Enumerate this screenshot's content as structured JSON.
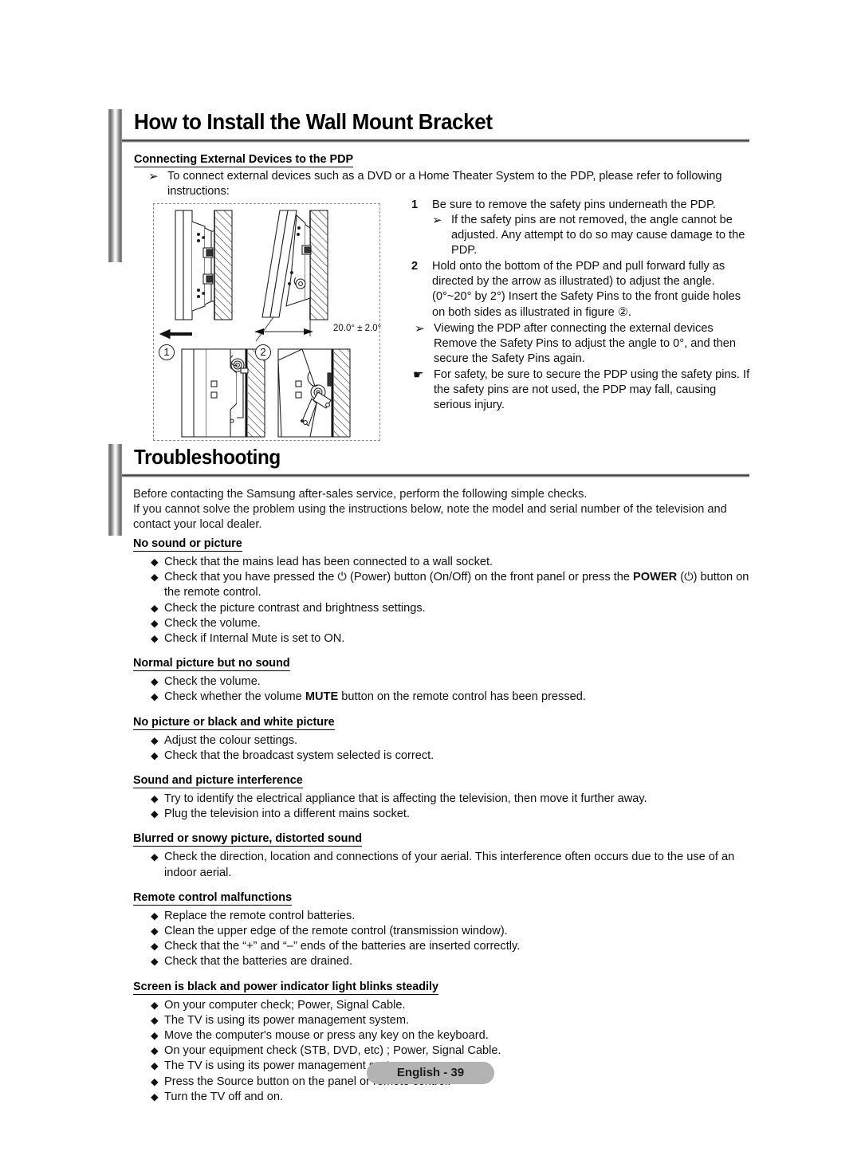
{
  "page": {
    "footer_label": "English - 39",
    "background": "#ffffff",
    "rail_color": "#8f8f8f"
  },
  "section1": {
    "title": "How to Install the Wall Mount Bracket",
    "subhead": "Connecting External Devices to the PDP",
    "intro": "To connect external devices such as a DVD or a Home Theater System to the PDP, please refer to following instructions:",
    "arrow_glyph": "➢",
    "hand_glyph": "☛",
    "steps": [
      {
        "num": "1",
        "text": "Be sure to remove the safety pins underneath the PDP.",
        "sub": "If the safety pins are not removed, the angle cannot be adjusted. Any attempt to do so may cause damage to the PDP."
      },
      {
        "num": "2",
        "text": "Hold onto the bottom of the PDP and pull forward fully as directed by the arrow as illustrated) to adjust the angle. (0°~20° by 2°) Insert the Safety Pins to the front guide holes on both sides as illustrated in figure ②."
      }
    ],
    "notes": [
      {
        "glyph": "arrow",
        "text": "Viewing the PDP after connecting the external devices Remove the Safety Pins to adjust the angle to 0°, and then secure the Safety Pins again."
      },
      {
        "glyph": "hand",
        "text": "For safety, be sure to secure the PDP using the safety pins. If the safety pins are not used, the PDP may fall, causing serious injury."
      }
    ],
    "figure": {
      "label_1": "①",
      "label_2": "②",
      "angle_label": "20.0° ± 2.0°",
      "caption_num_1": "1",
      "caption_num_2": "2"
    }
  },
  "section2": {
    "title": "Troubleshooting",
    "intro_line1": "Before contacting the Samsung after-sales service, perform the following simple checks.",
    "intro_line2": "If you cannot solve the problem using the instructions below, note the model and serial number of the television and contact your local dealer.",
    "diamond_glyph": "◆",
    "groups": [
      {
        "heading": "No sound or picture",
        "items": [
          "Check that the mains lead has been connected to a wall socket.",
          "Check that you have pressed the ⏻ (Power) button (On/Off) on the front panel or press the POWER (⏻) button on the remote control.",
          "Check the picture contrast and brightness settings.",
          "Check the volume.",
          "Check if Internal Mute is set to ON."
        ]
      },
      {
        "heading": "Normal picture but no sound",
        "items": [
          "Check the volume.",
          "Check whether the volume MUTE button on the remote control has been pressed."
        ]
      },
      {
        "heading": "No picture or black and white picture",
        "items": [
          "Adjust the colour settings.",
          "Check that the broadcast system selected is correct."
        ]
      },
      {
        "heading": "Sound and picture interference",
        "items": [
          "Try to identify the electrical appliance that is affecting the television, then move it further away.",
          "Plug the television into a different mains socket."
        ]
      },
      {
        "heading": "Blurred or snowy picture, distorted sound",
        "items": [
          "Check the direction, location and connections of your aerial. This interference often occurs due to the use of an indoor aerial."
        ]
      },
      {
        "heading": "Remote control malfunctions",
        "items": [
          "Replace the remote control batteries.",
          "Clean the upper edge of the remote control (transmission window).",
          "Check that the “+” and “–” ends of the batteries are inserted correctly.",
          "Check that the batteries are drained."
        ]
      },
      {
        "heading": "Screen is black and power indicator light blinks steadily",
        "items": [
          "On your computer check; Power, Signal Cable.",
          "The TV is using its power management system.",
          "Move the computer's mouse or press any key on the keyboard.",
          "On your equipment check (STB, DVD, etc) ; Power, Signal Cable.",
          "The TV is using its power management system.",
          "Press the Source button on the panel or remote control.",
          "Turn the TV off and on."
        ]
      }
    ]
  }
}
